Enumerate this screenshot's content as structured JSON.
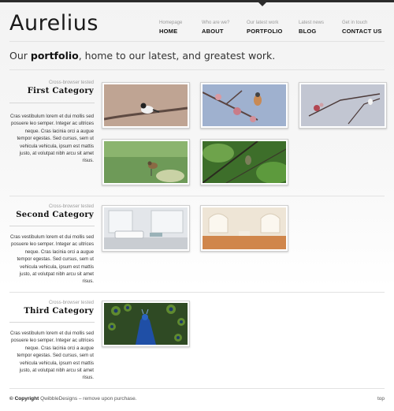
{
  "site": {
    "logo": "Aurelius",
    "tagline_prefix": "Our ",
    "tagline_strong": "portfolio",
    "tagline_rest": ", home to our latest, and greatest work."
  },
  "nav": {
    "items": [
      {
        "sub": "Homepage",
        "label": "HOME"
      },
      {
        "sub": "Who are we?",
        "label": "ABOUT"
      },
      {
        "sub": "Our latest work",
        "label": "PORTFOLIO",
        "active": true
      },
      {
        "sub": "Latest news",
        "label": "BLOG"
      },
      {
        "sub": "Get in touch",
        "label": "CONTACT US"
      }
    ]
  },
  "categories": [
    {
      "subtitle": "Cross-browser tested",
      "title": "First Category",
      "text": "Cras vestibulum lorem et dui mollis sed posuere leo semper. Integer ac ultrices neque. Cras lacinia orci a augue tempor egestas. Sed cursus, sem ut vehicula vehicula, ipsum est mattis justo, at volutpat nibh arcu sit amet risus.",
      "thumbnails": [
        "bird-on-branch",
        "bird-blossom-branch",
        "birds-on-twigs",
        "bird-green-field",
        "bird-green-foliage"
      ]
    },
    {
      "subtitle": "Cross-browser tested",
      "title": "Second Category",
      "text": "Cras vestibulum lorem et dui mollis sed posuere leo semper. Integer ac ultrices neque. Cras lacinia orci a augue tempor egestas. Sed cursus, sem ut vehicula vehicula, ipsum est mattis justo, at volutpat nibh arcu sit amet risus.",
      "thumbnails": [
        "white-living-room",
        "bright-empty-room"
      ]
    },
    {
      "subtitle": "Cross-browser tested",
      "title": "Third Category",
      "text": "Cras vestibulum lorem et dui mollis sed posuere leo semper. Integer ac ultrices neque. Cras lacinia orci a augue tempor egestas. Sed cursus, sem ut vehicula vehicula, ipsum est mattis justo, at volutpat nibh arcu sit amet risus.",
      "thumbnails": [
        "peacock"
      ]
    }
  ],
  "footer": {
    "copyright_strong": "© Copyright",
    "copyright_rest": " QwibbleDesigns – remove upon purchase.",
    "top_link": "top"
  },
  "colors": {
    "topbar": "#2b2b2b",
    "text": "#222222"
  }
}
